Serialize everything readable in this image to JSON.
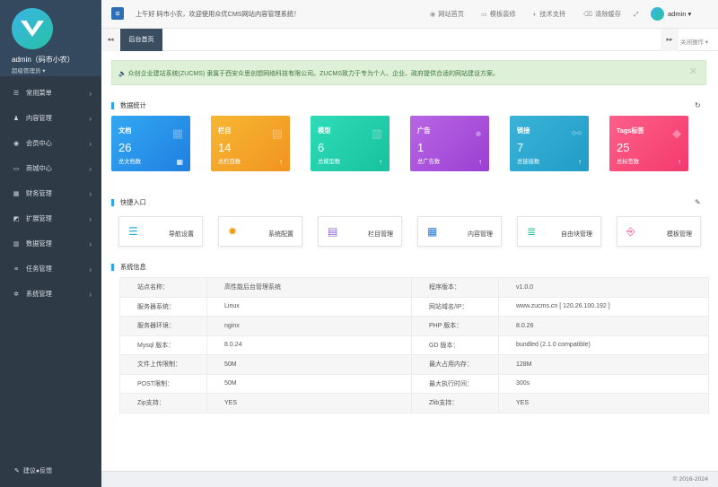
{
  "user": {
    "name": "admin（码市小农）",
    "role": "超级管理员 ▾"
  },
  "sidebar": {
    "items": [
      {
        "label": "常用菜单",
        "icon": "☰"
      },
      {
        "label": "内容管理",
        "icon": "♟"
      },
      {
        "label": "会员中心",
        "icon": "◉"
      },
      {
        "label": "商城中心",
        "icon": "▭"
      },
      {
        "label": "财务管理",
        "icon": "▦"
      },
      {
        "label": "扩展管理",
        "icon": "◩"
      },
      {
        "label": "数据管理",
        "icon": "▥"
      },
      {
        "label": "任务管理",
        "icon": "≡"
      },
      {
        "label": "系统管理",
        "icon": "✲"
      }
    ],
    "feedback": "建议●反馈",
    "arrow": "›"
  },
  "header": {
    "menu_icon": "≡",
    "welcome": "上午好 码市小农，欢迎使用众优CMS网站内容管理系统！",
    "links": [
      {
        "label": "网站首页",
        "icon": "◉"
      },
      {
        "label": "模板装修",
        "icon": "▭"
      },
      {
        "label": "技术支持",
        "icon": "◐"
      },
      {
        "label": "清除缓存",
        "icon": "⌫"
      }
    ],
    "fullscreen_icon": "⤢",
    "username": "admin ▾"
  },
  "tabs": {
    "prev": "◂◂",
    "next": "▸▸",
    "home": "后台首页",
    "close_ops": "关闭操作 ▾"
  },
  "alert": {
    "text": "🔈 众创企业建站系统(ZUCMS) 隶属于西安众思创想网络科技有限公司。ZUCMS致力于专为个人、企业、政府提供合适的网站建设方案。",
    "close": "✕"
  },
  "stats": {
    "title": "数据统计",
    "refresh_icon": "↻",
    "cards": [
      {
        "title": "文档",
        "value": "26",
        "sub": "总文档数",
        "icon": "▦",
        "action": "▦",
        "color1": "#33a8f2",
        "color2": "#1f7fe0"
      },
      {
        "title": "栏目",
        "value": "14",
        "sub": "总栏目数",
        "icon": "▤",
        "action": "↑",
        "color1": "#f7b733",
        "color2": "#f19420"
      },
      {
        "title": "模型",
        "value": "6",
        "sub": "总模型数",
        "icon": "▥",
        "action": "↑",
        "color1": "#2fdcb8",
        "color2": "#17c29f"
      },
      {
        "title": "广告",
        "value": "1",
        "sub": "总广告数",
        "icon": "●",
        "action": "↑",
        "color1": "#b866e4",
        "color2": "#9b3fd3"
      },
      {
        "title": "链接",
        "value": "7",
        "sub": "总链接数",
        "icon": "⚯",
        "action": "↑",
        "color1": "#3cb3d8",
        "color2": "#1f9cc6"
      },
      {
        "title": "Tags标签",
        "value": "25",
        "sub": "总标签数",
        "icon": "◆",
        "action": "↑",
        "color1": "#ff5f8a",
        "color2": "#f23a6d"
      }
    ]
  },
  "quick": {
    "title": "快捷入口",
    "edit_icon": "✎",
    "items": [
      {
        "label": "导航设置",
        "icon": "☰",
        "color": "#2ea7e0"
      },
      {
        "label": "系统配置",
        "icon": "✹",
        "color": "#f39c12"
      },
      {
        "label": "栏目管理",
        "icon": "▤",
        "color": "#8e6cc9"
      },
      {
        "label": "内容管理",
        "icon": "▦",
        "color": "#2f7fd8"
      },
      {
        "label": "自由块管理",
        "icon": "≣",
        "color": "#2bc6a1"
      },
      {
        "label": "模板管理",
        "icon": "⎆",
        "color": "#e84393"
      }
    ]
  },
  "sysinfo": {
    "title": "系统信息",
    "rows": [
      [
        "站点名称：",
        "高性能后台管理系统",
        "程序版本：",
        "v1.0.0"
      ],
      [
        "服务器系统：",
        "Linux",
        "网站域名/IP：",
        "www.zucms.cn [ 120.26.100.192 ]"
      ],
      [
        "服务器环境：",
        "nginx",
        "PHP 版本：",
        "8.0.26"
      ],
      [
        "Mysql 版本：",
        "8.0.24",
        "GD 版本：",
        "bundled (2.1.0 compatible)"
      ],
      [
        "文件上传限制：",
        "50M",
        "最大占用内存：",
        "128M"
      ],
      [
        "POST限制：",
        "50M",
        "最大执行时间：",
        "300s"
      ],
      [
        "Zip支持：",
        "YES",
        "Zlib支持：",
        "YES"
      ]
    ]
  },
  "footer": {
    "copyright": "© 2016-2024"
  }
}
